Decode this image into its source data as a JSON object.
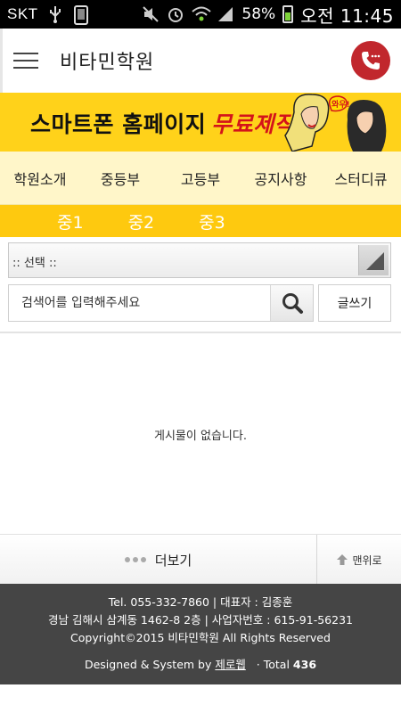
{
  "status_bar": {
    "carrier": "SKT",
    "battery": "58%",
    "time": "오전 11:45",
    "icons": [
      "usb-icon",
      "screenshot-icon",
      "mute-icon",
      "alarm-icon",
      "wifi-icon",
      "signal-icon",
      "battery-icon"
    ]
  },
  "header": {
    "title": "비타민학원",
    "menu_icon": "hamburger-icon",
    "call_icon": "phone-icon",
    "call_color": "#c1272d"
  },
  "banner": {
    "text": "스마트폰 홈페이지",
    "highlight": "무료제작!",
    "bubble": "와우!",
    "bg_color": "#ffd21a"
  },
  "nav": {
    "items": [
      "학원소개",
      "중등부",
      "고등부",
      "공지사항",
      "스터디큐"
    ]
  },
  "subnav": {
    "items": [
      "중1",
      "중2",
      "중3"
    ],
    "bg_color": "#fec90f"
  },
  "board": {
    "select_label": ":: 선택 ::",
    "search_placeholder": "검색어를 입력해주세요",
    "write_label": "글쓰기",
    "empty_message": "게시물이 없습니다."
  },
  "actions": {
    "more_label": "더보기",
    "top_label": "맨위로"
  },
  "footer": {
    "line1": "Tel. 055-332-7860 | 대표자 : 김종훈",
    "line2": "경남 김해시 삼계동 1462-8 2층 | 사업자번호 : 615-91-56231",
    "line3": "Copyright©2015 비타민학원 All Rights Reserved",
    "designed_prefix": "Designed & System by",
    "designer": "제로웹",
    "total_prefix": "· Total",
    "total": "436",
    "bg_color": "#454545"
  }
}
